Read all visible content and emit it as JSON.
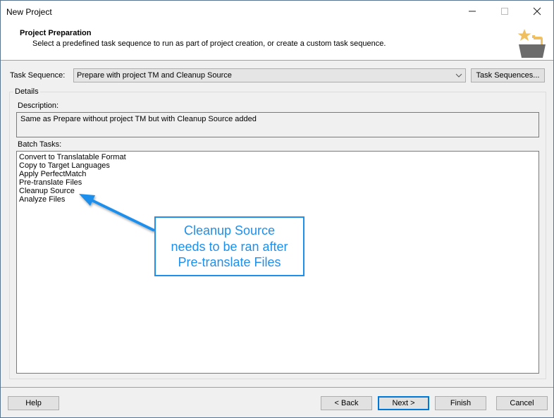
{
  "window": {
    "title": "New Project",
    "controls": {
      "minimize": "—",
      "maximize": "☐",
      "close": "✕"
    }
  },
  "header": {
    "title": "Project Preparation",
    "subtitle": "Select a predefined task sequence to run as part of project creation, or create a custom task sequence.",
    "logo_icon": "batch-tasks-star-bucket-icon"
  },
  "task_sequence": {
    "label": "Task Sequence:",
    "selected": "Prepare with project TM and Cleanup Source",
    "button_label": "Task Sequences..."
  },
  "details": {
    "group_label": "Details",
    "description_label": "Description:",
    "description_value": "Same as Prepare without project TM but with Cleanup Source added",
    "batch_tasks_label": "Batch Tasks:",
    "batch_tasks": [
      "Convert to Translatable Format",
      "Copy to Target Languages",
      "Apply PerfectMatch",
      "Pre-translate Files",
      "Cleanup Source",
      "Analyze Files"
    ]
  },
  "annotation": {
    "lines": [
      "Cleanup Source",
      "needs to be ran after",
      "Pre-translate Files"
    ],
    "color": "#1f8fec"
  },
  "footer": {
    "help": "Help",
    "back": "< Back",
    "next": "Next >",
    "finish": "Finish",
    "cancel": "Cancel"
  }
}
